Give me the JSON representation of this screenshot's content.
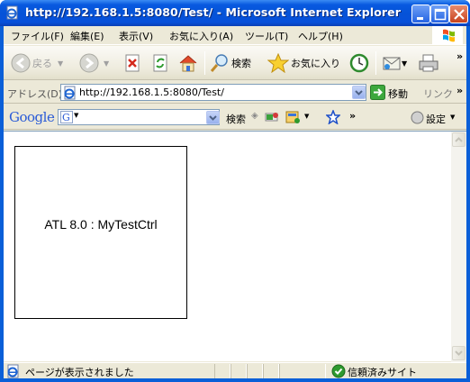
{
  "window": {
    "title": "http://192.168.1.5:8080/Test/ - Microsoft Internet Explorer"
  },
  "menubar": {
    "items": [
      "ファイル(F)",
      "編集(E)",
      "表示(V)",
      "お気に入り(A)",
      "ツール(T)",
      "ヘルプ(H)"
    ]
  },
  "toolbar": {
    "back_label": "戻る",
    "search_label": "検索",
    "favorites_label": "お気に入り",
    "more": "»"
  },
  "addressbar": {
    "label": "アドレス(D)",
    "url": "http://192.168.1.5:8080/Test/",
    "go_label": "移動",
    "links_label": "リンク",
    "more": "»"
  },
  "googlebar": {
    "logo": "Google",
    "search_label": "検索",
    "more": "»",
    "settings_label": "設定"
  },
  "content": {
    "control_text": "ATL 8.0 : MyTestCtrl"
  },
  "statusbar": {
    "status": "ページが表示されました",
    "zone": "信頼済みサイト"
  },
  "colors": {
    "titlebar": "#0553D8",
    "chrome": "#ECE9D8",
    "close_button": "#C7431F"
  }
}
